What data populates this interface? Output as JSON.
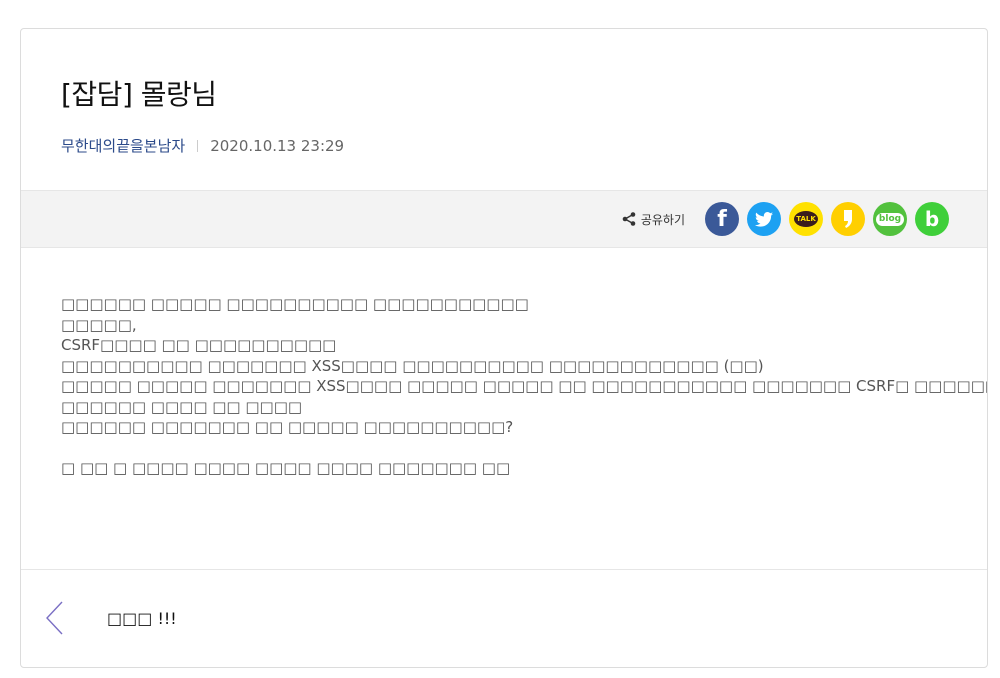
{
  "post": {
    "title": "[잡담] 몰랑님",
    "author": "무한대의끝을본남자",
    "date": "2020.10.13 23:29"
  },
  "share": {
    "label": "공유하기",
    "buttons": [
      {
        "id": "facebook",
        "icon": "facebook-icon",
        "text": "f",
        "color": "#3b5998"
      },
      {
        "id": "twitter",
        "icon": "twitter-icon",
        "color": "#1da1f2"
      },
      {
        "id": "kakaotalk",
        "icon": "kakaotalk-icon",
        "text": "TALK",
        "color": "#ffe100"
      },
      {
        "id": "kakaostory",
        "icon": "kakaostory-icon",
        "color": "#ffcf00"
      },
      {
        "id": "naver-blog",
        "icon": "naver-blog-icon",
        "text": "blog",
        "color": "#52c13d"
      },
      {
        "id": "band",
        "icon": "band-icon",
        "text": "b",
        "color": "#3fcf3a"
      }
    ]
  },
  "content": {
    "lines": [
      "□□□□□□ □□□□□ □□□□□□□□□□ □□□□□□□□□□□",
      "□□□□□,",
      "CSRF□□□□ □□ □□□□□□□□□□",
      "□□□□□□□□□□ □□□□□□□ XSS□□□□ □□□□□□□□□□ □□□□□□□□□□□□ (□□)",
      "□□□□□ □□□□□ □□□□□□□ XSS□□□□ □□□□□ □□□□□ □□ □□□□□□□□□□□ □□□□□□□ CSRF□ □□□□□□?",
      "□□□□□□ □□□□ □□ □□□□",
      "□□□□□□ □□□□□□□ □□ □□□□□ □□□□□□□□□□?",
      "",
      "□ □□ □ □□□□ □□□□ □□□□ □□□□ □□□□□□□ □□"
    ]
  },
  "navigation": {
    "prev_label": "□□□   !!!"
  }
}
